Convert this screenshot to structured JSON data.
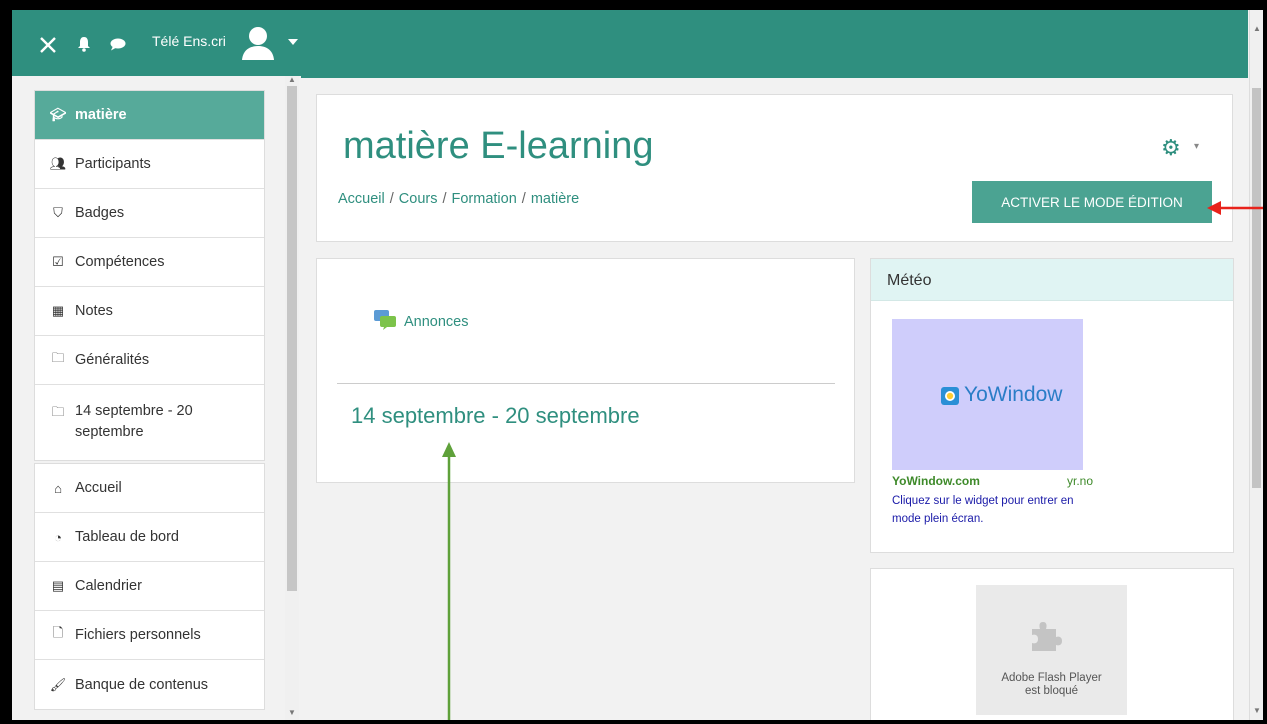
{
  "navbar": {
    "user_name": "Télé Ens.cri",
    "icons": [
      "close-icon",
      "bell-icon",
      "chat-icon",
      "avatar-icon",
      "caret-down-icon"
    ]
  },
  "drawer": {
    "course_items": [
      {
        "label": "matière",
        "icon": "graduation-cap-icon",
        "active": true
      },
      {
        "label": "Participants",
        "icon": "users-icon"
      },
      {
        "label": "Badges",
        "icon": "shield-icon"
      },
      {
        "label": "Compétences",
        "icon": "checkbox-icon"
      },
      {
        "label": "Notes",
        "icon": "table-icon"
      },
      {
        "label": "Généralités",
        "icon": "folder-icon"
      },
      {
        "label": "14 septembre - 20 septembre",
        "icon": "folder-icon"
      }
    ],
    "site_items": [
      {
        "label": "Accueil",
        "icon": "home-icon"
      },
      {
        "label": "Tableau de bord",
        "icon": "dashboard-icon"
      },
      {
        "label": "Calendrier",
        "icon": "calendar-icon"
      },
      {
        "label": "Fichiers personnels",
        "icon": "file-icon"
      },
      {
        "label": "Banque de contenus",
        "icon": "brush-icon"
      }
    ]
  },
  "header": {
    "title": "matière E-learning",
    "breadcrumb": [
      "Accueil",
      "Cours",
      "Formation",
      "matière"
    ],
    "breadcrumb_separator": "/",
    "edit_button": "ACTIVER LE MODE ÉDITION"
  },
  "content": {
    "announcements_link": "Annonces",
    "section_title": "14 septembre - 20 septembre"
  },
  "meteo": {
    "title": "Météo",
    "widget_brand": "YoWindow",
    "site_left": "YoWindow.com",
    "site_right": "yr.no",
    "description": "Cliquez sur le widget pour entrer en mode plein écran."
  },
  "flash": {
    "line1": "Adobe Flash Player",
    "line2": "est bloqué"
  },
  "colors": {
    "brand": "#2f8f7f",
    "active_item": "#56aa9a",
    "button": "#4ba392",
    "meteo_header": "#e0f4f3",
    "annotation_red": "#e8221b",
    "annotation_green": "#5fa13a"
  }
}
